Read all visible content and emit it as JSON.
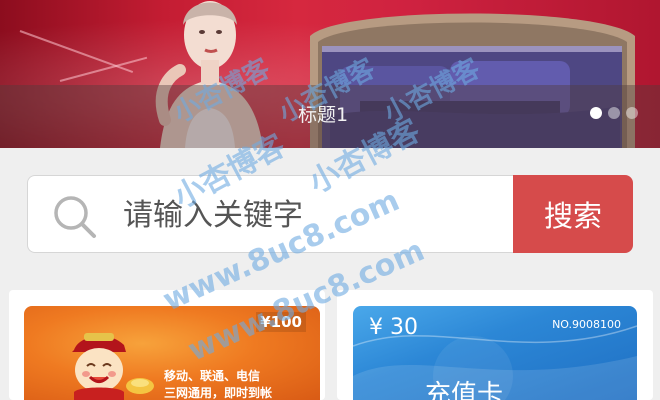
{
  "banner": {
    "caption": "标题1",
    "dots_total": 3,
    "active_dot": 1
  },
  "search": {
    "placeholder": "请输入关键字",
    "button_label": "搜索"
  },
  "cards": {
    "left": {
      "amount": "¥100",
      "text_line1": "移动、联通、电信",
      "text_line2": "三网通用，即时到帐"
    },
    "right": {
      "amount": "¥ 30",
      "number": "NO.9008100",
      "title": "充值卡"
    }
  },
  "watermark": {
    "brand": "小杏博客",
    "url": "www.8uc8.com"
  },
  "colors": {
    "search_button": "#d64b4b",
    "banner_red": "#c41d33",
    "card_orange": "#ef7a21",
    "card_blue": "#2c87d6"
  }
}
